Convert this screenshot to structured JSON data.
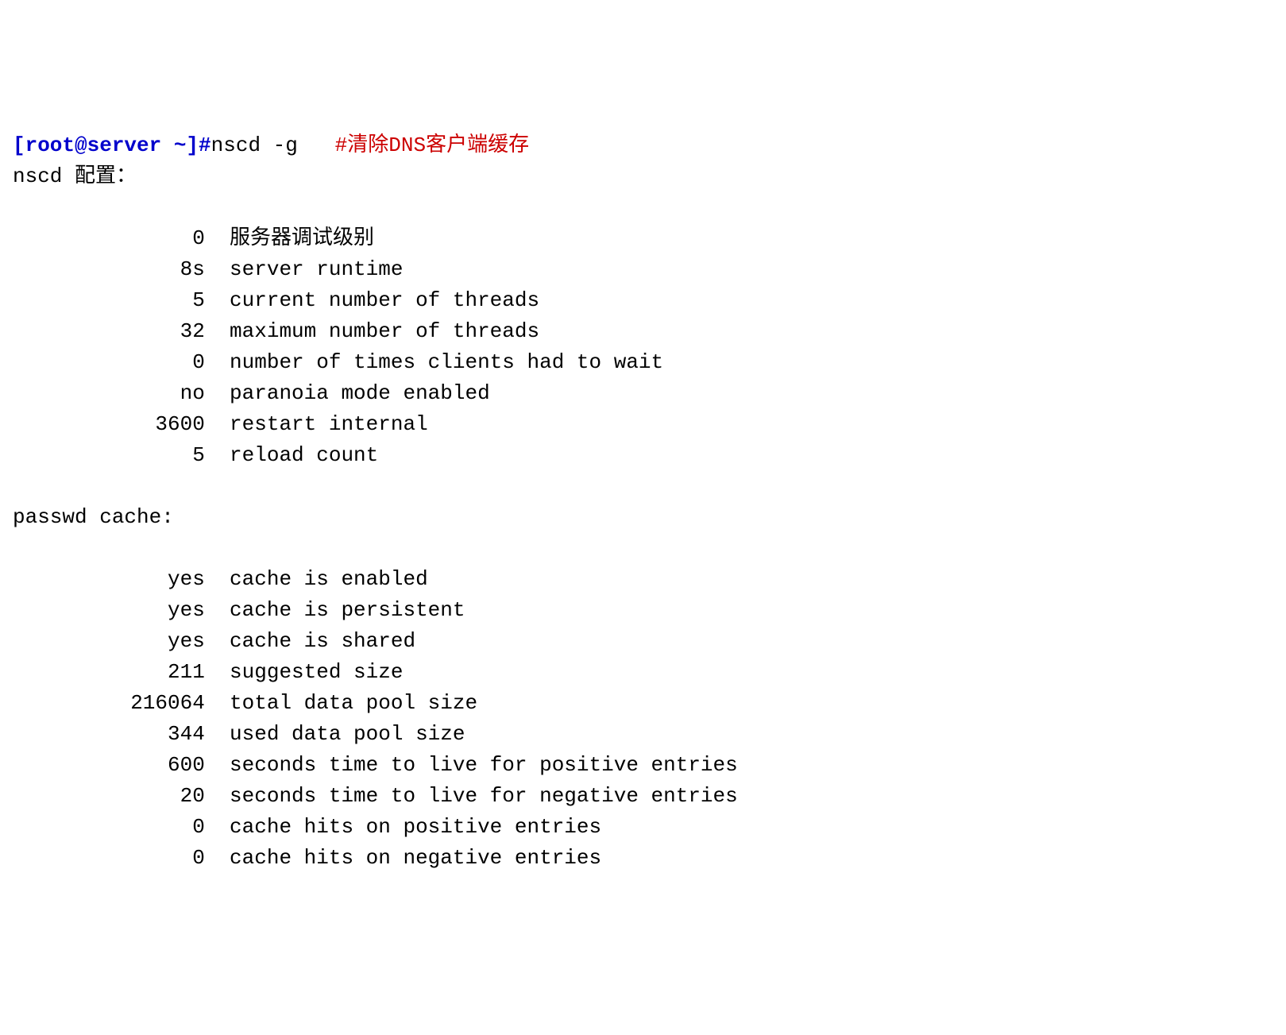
{
  "prompt": "[root@server ~]#",
  "command": "nscd -g",
  "comment": "#清除DNS客户端缓存",
  "header1": "nscd 配置：",
  "config_rows": [
    {
      "value": "0",
      "label": "服务器调试级别"
    },
    {
      "value": "8s",
      "label": "server runtime"
    },
    {
      "value": "5",
      "label": "current number of threads"
    },
    {
      "value": "32",
      "label": "maximum number of threads"
    },
    {
      "value": "0",
      "label": "number of times clients had to wait"
    },
    {
      "value": "no",
      "label": "paranoia mode enabled"
    },
    {
      "value": "3600",
      "label": "restart internal"
    },
    {
      "value": "5",
      "label": "reload count"
    }
  ],
  "header2": "passwd cache:",
  "passwd_rows": [
    {
      "value": "yes",
      "label": "cache is enabled"
    },
    {
      "value": "yes",
      "label": "cache is persistent"
    },
    {
      "value": "yes",
      "label": "cache is shared"
    },
    {
      "value": "211",
      "label": "suggested size"
    },
    {
      "value": "216064",
      "label": "total data pool size"
    },
    {
      "value": "344",
      "label": "used data pool size"
    },
    {
      "value": "600",
      "label": "seconds time to live for positive entries"
    },
    {
      "value": "20",
      "label": "seconds time to live for negative entries"
    },
    {
      "value": "0",
      "label": "cache hits on positive entries"
    },
    {
      "value": "0",
      "label": "cache hits on negative entries"
    }
  ]
}
